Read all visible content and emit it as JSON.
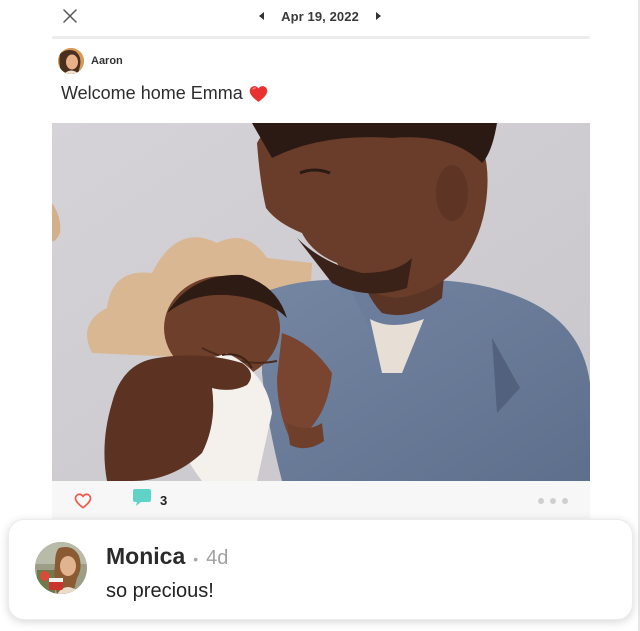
{
  "header": {
    "date": "Apr 19, 2022",
    "close_icon": "close-icon",
    "prev_icon": "caret-left-icon",
    "next_icon": "caret-right-icon"
  },
  "post": {
    "author": "Aaron",
    "caption": "Welcome home Emma",
    "caption_emoji": "red-heart-emoji",
    "photo": "man-holding-newborn-baby-photo",
    "comment_count": "3",
    "like_icon": "heart-outline-icon",
    "comment_icon": "speech-bubble-icon",
    "more_icon": "more-dots-icon"
  },
  "comment": {
    "name": "Monica",
    "separator": "•",
    "time": "4d",
    "text": "so precious!"
  },
  "colors": {
    "like": "#ef5a4c",
    "comment_bubble": "#5fd3c8",
    "heart_emoji": "#e8322f",
    "muted": "#a0a0a0"
  }
}
